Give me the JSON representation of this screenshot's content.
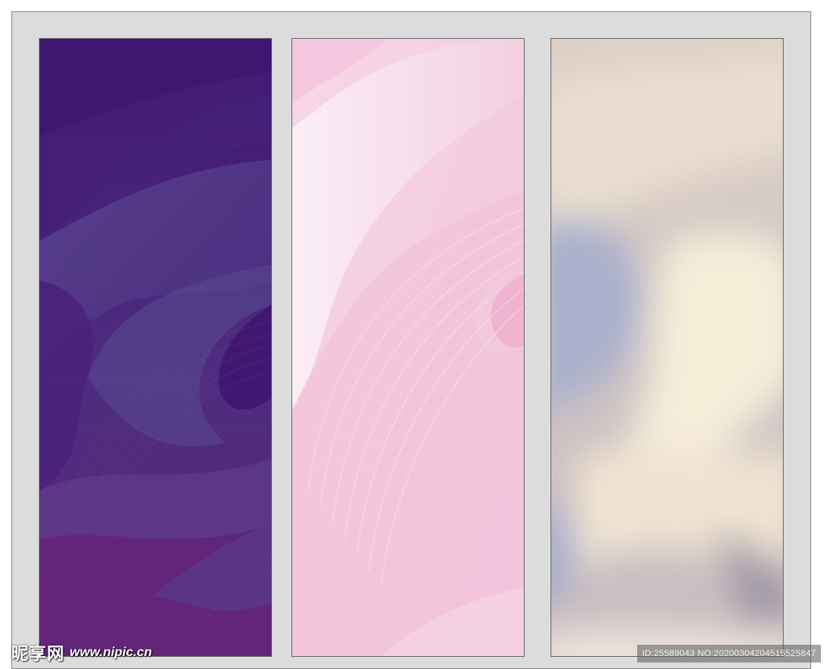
{
  "panels": [
    {
      "name": "purple-wave-panel",
      "colors": [
        "#3f1a72",
        "#513a86",
        "#6a2a80"
      ]
    },
    {
      "name": "pink-wave-panel",
      "colors": [
        "#f6d3e4",
        "#f7e8f0",
        "#efb8d3"
      ]
    },
    {
      "name": "cream-blur-panel",
      "colors": [
        "#d8cbc3",
        "#f3ead8",
        "#a8acc8"
      ]
    }
  ],
  "watermark": {
    "brand": "昵享网",
    "site": "www.nipic.cn",
    "id_text": "ID:25589043 NO:20200304204515525847"
  }
}
